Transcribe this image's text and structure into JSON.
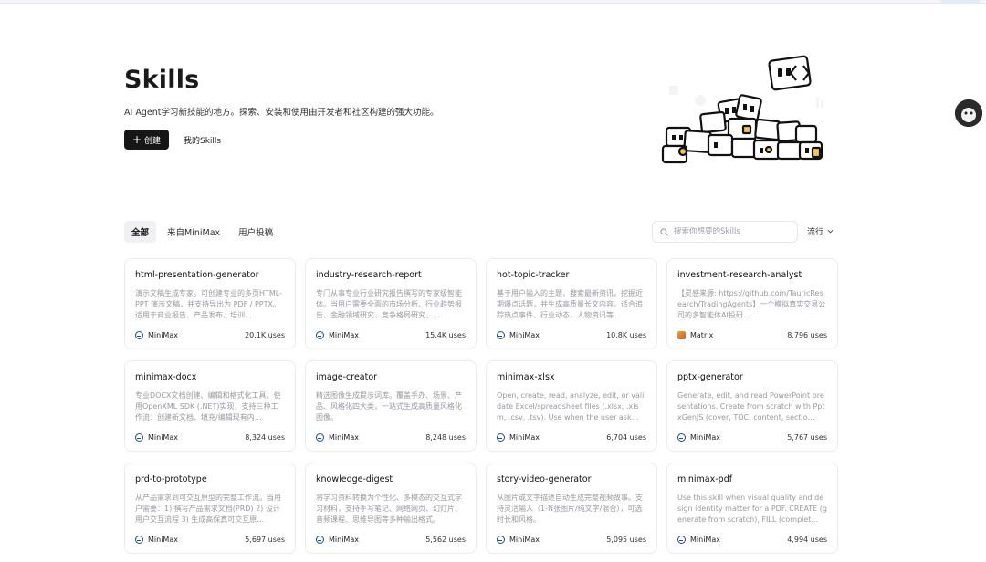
{
  "header": {
    "title": "Skills",
    "subtitle": "AI Agent学习新技能的地方。探索、安装和使用由开发者和社区构建的强大功能。",
    "create_label": "创建",
    "my_skills_label": "我的Skills"
  },
  "filters": {
    "tabs": [
      "全部",
      "来自MiniMax",
      "用户投稿"
    ],
    "active_tab": "全部",
    "search_placeholder": "搜索你想要的Skills",
    "sort_label": "流行"
  },
  "cards": [
    {
      "title": "html-presentation-generator",
      "desc": "演示文稿生成专家。可创建专业的多页HTML-PPT 演示文稿，并支持导出为 PDF / PPTX。适用于商业报告、产品发布、培训…",
      "author": "MiniMax",
      "uses": "20.1K uses",
      "icon": "minimax-logo-icon"
    },
    {
      "title": "industry-research-report",
      "desc": "专门从事专业行业研究报告撰写的专家级智能体。当用户需要全面的市场分析、行业趋势报告、金融领域研究、竞争格局研究、…",
      "author": "MiniMax",
      "uses": "15.4K uses",
      "icon": "minimax-logo-icon"
    },
    {
      "title": "hot-topic-tracker",
      "desc": "基于用户输入的主题，搜索最新资讯，挖掘近期爆点话题，并生成高质量长文内容。适合追踪热点事件、行业动态、人物资讯等…",
      "author": "MiniMax",
      "uses": "10.8K uses",
      "icon": "minimax-logo-icon"
    },
    {
      "title": "investment-research-analyst",
      "desc": "【灵感来源: https://github.com/TauricResearch/TradingAgents】一个模拟真实交易公司的多智能体AI投研…",
      "author": "Matrix",
      "uses": "8,796 uses",
      "icon": "matrix-logo-icon"
    },
    {
      "title": "minimax-docx",
      "desc": "专业DOCX文档创建、编辑和格式化工具。使用OpenXML SDK (.NET)实现，支持三种工作流：创建新文档、填充/编辑现有内…",
      "author": "MiniMax",
      "uses": "8,324 uses",
      "icon": "minimax-logo-icon"
    },
    {
      "title": "image-creator",
      "desc": "精选图像生成提示词库。覆盖手办、场景、产品、风格化四大类，一站式生成高质量风格化图像。",
      "author": "MiniMax",
      "uses": "8,248 uses",
      "icon": "minimax-logo-icon"
    },
    {
      "title": "minimax-xlsx",
      "desc": "Open, create, read, analyze, edit, or validate Excel/spreadsheet files (.xlsx, .xlsm, .csv, .tsv). Use when the user ask…",
      "author": "MiniMax",
      "uses": "6,704 uses",
      "icon": "minimax-logo-icon"
    },
    {
      "title": "pptx-generator",
      "desc": "Generate, edit, and read PowerPoint presentations. Create from scratch with PptxGenJS (cover, TOC, content, sectio…",
      "author": "MiniMax",
      "uses": "5,767 uses",
      "icon": "minimax-logo-icon"
    },
    {
      "title": "prd-to-prototype",
      "desc": "从产品需求到可交互原型的完整工作流。当用户需要：1) 撰写产品需求文档(PRD) 2) 设计用户交互流程 3) 生成高保真可交互原…",
      "author": "MiniMax",
      "uses": "5,697 uses",
      "icon": "minimax-logo-icon"
    },
    {
      "title": "knowledge-digest",
      "desc": "将学习资料转换为个性化、多模态的交互式学习材料，支持手写笔记、网络网页、幻灯片、音频课程、思维导图等多种输出格式。",
      "author": "MiniMax",
      "uses": "5,562 uses",
      "icon": "minimax-logo-icon"
    },
    {
      "title": "story-video-generator",
      "desc": "从图片或文字描述自动生成完整视频故事。支持灵活输入（1-N张图片/纯文字/混合），可选时长和风格。",
      "author": "MiniMax",
      "uses": "5,095 uses",
      "icon": "minimax-logo-icon"
    },
    {
      "title": "minimax-pdf",
      "desc": "Use this skill when visual quality and design identity matter for a PDF. CREATE (generate from scratch), FILL (complet…",
      "author": "MiniMax",
      "uses": "4,994 uses",
      "icon": "minimax-logo-icon"
    }
  ]
}
